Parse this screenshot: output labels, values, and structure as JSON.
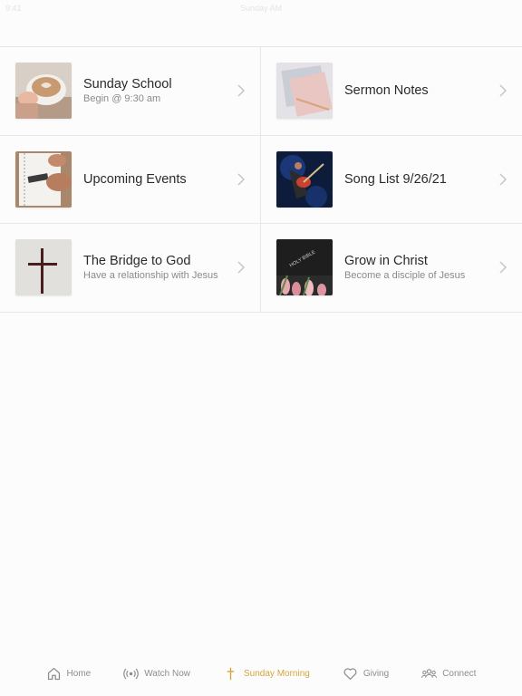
{
  "status": {
    "left": "9:41",
    "center": "Sunday AM"
  },
  "tiles": [
    {
      "title": "Sunday School",
      "subtitle": "Begin @ 9:30 am",
      "image": "coffee-cup"
    },
    {
      "title": "Sermon Notes",
      "subtitle": "",
      "image": "notebooks"
    },
    {
      "title": "Upcoming Events",
      "subtitle": "",
      "image": "writing-notebook"
    },
    {
      "title": "Song List 9/26/21",
      "subtitle": "",
      "image": "guitarist"
    },
    {
      "title": "The Bridge to God",
      "subtitle": "Have a relationship with Jesus",
      "image": "cross"
    },
    {
      "title": "Grow in Christ",
      "subtitle": "Become a disciple of Jesus",
      "image": "holy-bible"
    }
  ],
  "bible_cover_text": "HOLY BIBLE",
  "tabs": [
    {
      "label": "Home",
      "icon": "home-icon",
      "active": false
    },
    {
      "label": "Watch Now",
      "icon": "broadcast-icon",
      "active": false
    },
    {
      "label": "Sunday Morning",
      "icon": "cross-icon",
      "active": true
    },
    {
      "label": "Giving",
      "icon": "heart-icon",
      "active": false
    },
    {
      "label": "Connect",
      "icon": "people-icon",
      "active": false
    }
  ],
  "colors": {
    "accent": "#d4a53c",
    "inactive": "#8d8d8d",
    "divider": "#e8e8e8"
  }
}
